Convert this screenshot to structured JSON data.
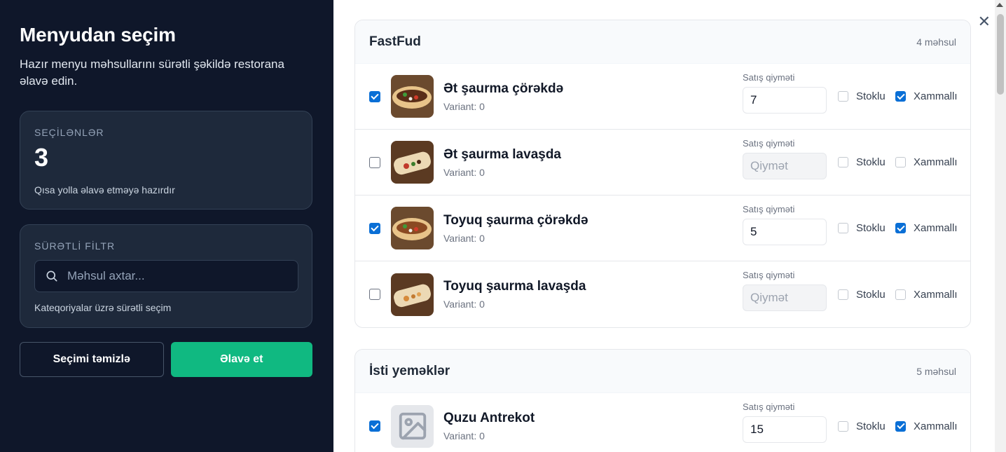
{
  "sidebar": {
    "title": "Menyudan seçim",
    "subtitle": "Hazır menyu məhsullarını sürətli şəkildə restorana əlavə edin.",
    "selected": {
      "label": "SEÇİLƏNLƏR",
      "count": "3",
      "hint": "Qısa yolla əlavə etməyə hazırdır"
    },
    "filter": {
      "label": "SÜRƏTLİ FİLTR",
      "placeholder": "Məhsul axtar...",
      "hint": "Kateqoriyalar üzrə sürətli seçim"
    },
    "clear_label": "Seçimi təmizlə",
    "add_label": "Əlavə et"
  },
  "labels": {
    "price": "Satış qiyməti",
    "price_placeholder": "Qiymət",
    "stock": "Stoklu",
    "raw": "Xammallı"
  },
  "categories": [
    {
      "name": "FastFud",
      "count_text": "4 məhsul",
      "items": [
        {
          "name": "Ət şaurma çörəkdə",
          "variant": "Variant: 0",
          "selected": true,
          "price": "7",
          "stock": false,
          "raw": true,
          "image": "shawarma-bread"
        },
        {
          "name": "Ət şaurma lavaşda",
          "variant": "Variant: 0",
          "selected": false,
          "price": "",
          "stock": false,
          "raw": false,
          "image": "shawarma-wrap"
        },
        {
          "name": "Toyuq şaurma çörəkdə",
          "variant": "Variant: 0",
          "selected": true,
          "price": "5",
          "stock": false,
          "raw": true,
          "image": "shawarma-bread"
        },
        {
          "name": "Toyuq şaurma lavaşda",
          "variant": "Variant: 0",
          "selected": false,
          "price": "",
          "stock": false,
          "raw": false,
          "image": "shawarma-wrap"
        }
      ]
    },
    {
      "name": "İsti yeməklər",
      "count_text": "5 məhsul",
      "items": [
        {
          "name": "Quzu Antrekot",
          "variant": "Variant: 0",
          "selected": true,
          "price": "15",
          "stock": false,
          "raw": true,
          "image": "placeholder-image-icon"
        }
      ]
    }
  ],
  "colors": {
    "sidebar_bg": "#0f172a",
    "card_bg": "#1e293b",
    "accent_green": "#10b981",
    "checkbox_blue": "#0a6fd6"
  }
}
